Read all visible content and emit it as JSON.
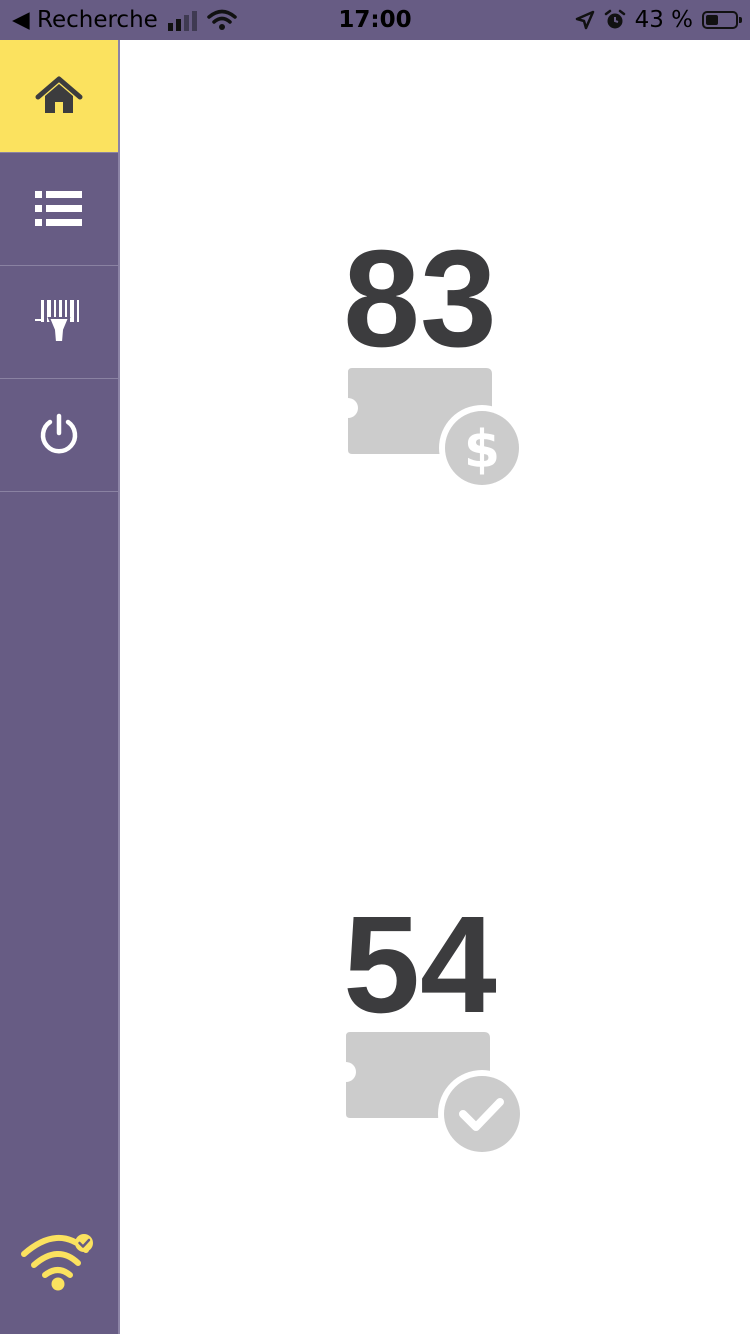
{
  "status_bar": {
    "back_label": "◀ Recherche",
    "time": "17:00",
    "battery": "43 %",
    "battery_level": 0.43
  },
  "sidebar": {
    "items": [
      {
        "icon": "home-icon",
        "active": true
      },
      {
        "icon": "list-icon",
        "active": false
      },
      {
        "icon": "barcode-scanner-icon",
        "active": false
      },
      {
        "icon": "power-icon",
        "active": false
      }
    ],
    "connection_icon": "wifi-connected-icon"
  },
  "main": {
    "paid_count": "83",
    "paid_icon": "ticket-dollar-icon",
    "validated_count": "54",
    "validated_icon": "ticket-check-icon"
  },
  "colors": {
    "brand_purple": "#675c84",
    "accent_yellow": "#fbe25f",
    "counter_text": "#3c3c3e",
    "icon_gray": "#cccccc"
  }
}
